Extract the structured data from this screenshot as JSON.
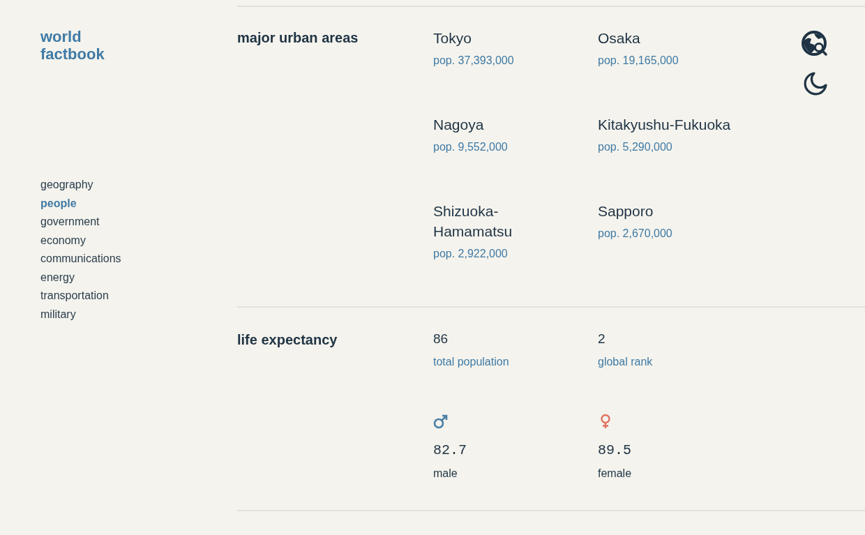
{
  "logo": {
    "line_1": "world",
    "line_2": "factbook"
  },
  "nav": [
    {
      "label": "geography",
      "selected": false
    },
    {
      "label": "people",
      "selected": true
    },
    {
      "label": "government",
      "selected": false
    },
    {
      "label": "economy",
      "selected": false
    },
    {
      "label": "communications",
      "selected": false
    },
    {
      "label": "energy",
      "selected": false
    },
    {
      "label": "transportation",
      "selected": false
    },
    {
      "label": "military",
      "selected": false
    }
  ],
  "urban_areas": {
    "title": "major urban areas",
    "cities": [
      {
        "name": "Tokyo",
        "population": "pop. 37,393,000"
      },
      {
        "name": "Osaka",
        "population": "pop. 19,165,000"
      },
      {
        "name": "Nagoya",
        "population": "pop. 9,552,000"
      },
      {
        "name": "Kitakyushu-Fukuoka",
        "population": "pop. 5,290,000"
      },
      {
        "name": "Shizuoka-Hamamatsu",
        "population": "pop. 2,922,000"
      },
      {
        "name": "Sapporo",
        "population": "pop. 2,670,000"
      }
    ]
  },
  "life_expectancy": {
    "title": "life expectancy",
    "stats": [
      {
        "value": "86",
        "label": "total population"
      },
      {
        "value": "2",
        "label": "global rank"
      }
    ],
    "by_sex": [
      {
        "kind": "male",
        "value": "82.7",
        "label": "male"
      },
      {
        "kind": "female",
        "value": "89.5",
        "label": "female"
      }
    ]
  }
}
